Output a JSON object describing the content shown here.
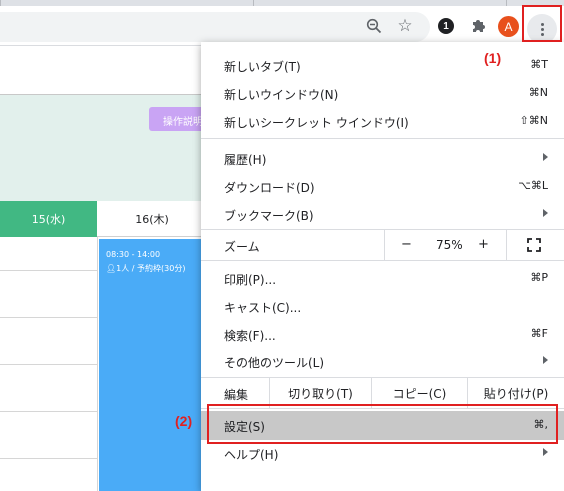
{
  "browser": {
    "profile_initial": "A",
    "extension_badge": "1"
  },
  "page": {
    "guide_button": "操作説明",
    "calendar": {
      "day_wed": "15(水)",
      "day_thu": "16(木)",
      "event_time": "08:30 - 14:00",
      "event_detail": "1人 / 予約枠(30分)"
    }
  },
  "menu": {
    "new_tab": {
      "label": "新しいタブ(T)",
      "shortcut": "⌘T"
    },
    "new_window": {
      "label": "新しいウインドウ(N)",
      "shortcut": "⌘N"
    },
    "incognito": {
      "label": "新しいシークレット ウインドウ(I)",
      "shortcut": "⇧⌘N"
    },
    "history": {
      "label": "履歴(H)"
    },
    "downloads": {
      "label": "ダウンロード(D)",
      "shortcut": "⌥⌘L"
    },
    "bookmarks": {
      "label": "ブックマーク(B)"
    },
    "zoom": {
      "label": "ズーム",
      "minus": "−",
      "value": "75%",
      "plus": "+"
    },
    "print": {
      "label": "印刷(P)...",
      "shortcut": "⌘P"
    },
    "cast": {
      "label": "キャスト(C)..."
    },
    "find": {
      "label": "検索(F)...",
      "shortcut": "⌘F"
    },
    "more_tools": {
      "label": "その他のツール(L)"
    },
    "edit": {
      "label": "編集",
      "cut": "切り取り(T)",
      "copy": "コピー(C)",
      "paste": "貼り付け(P)"
    },
    "settings": {
      "label": "設定(S)",
      "shortcut": "⌘,"
    },
    "help": {
      "label": "ヘルプ(H)"
    }
  },
  "annotations": {
    "step1": "(1)",
    "step2": "(2)",
    "color": "#e02020"
  }
}
